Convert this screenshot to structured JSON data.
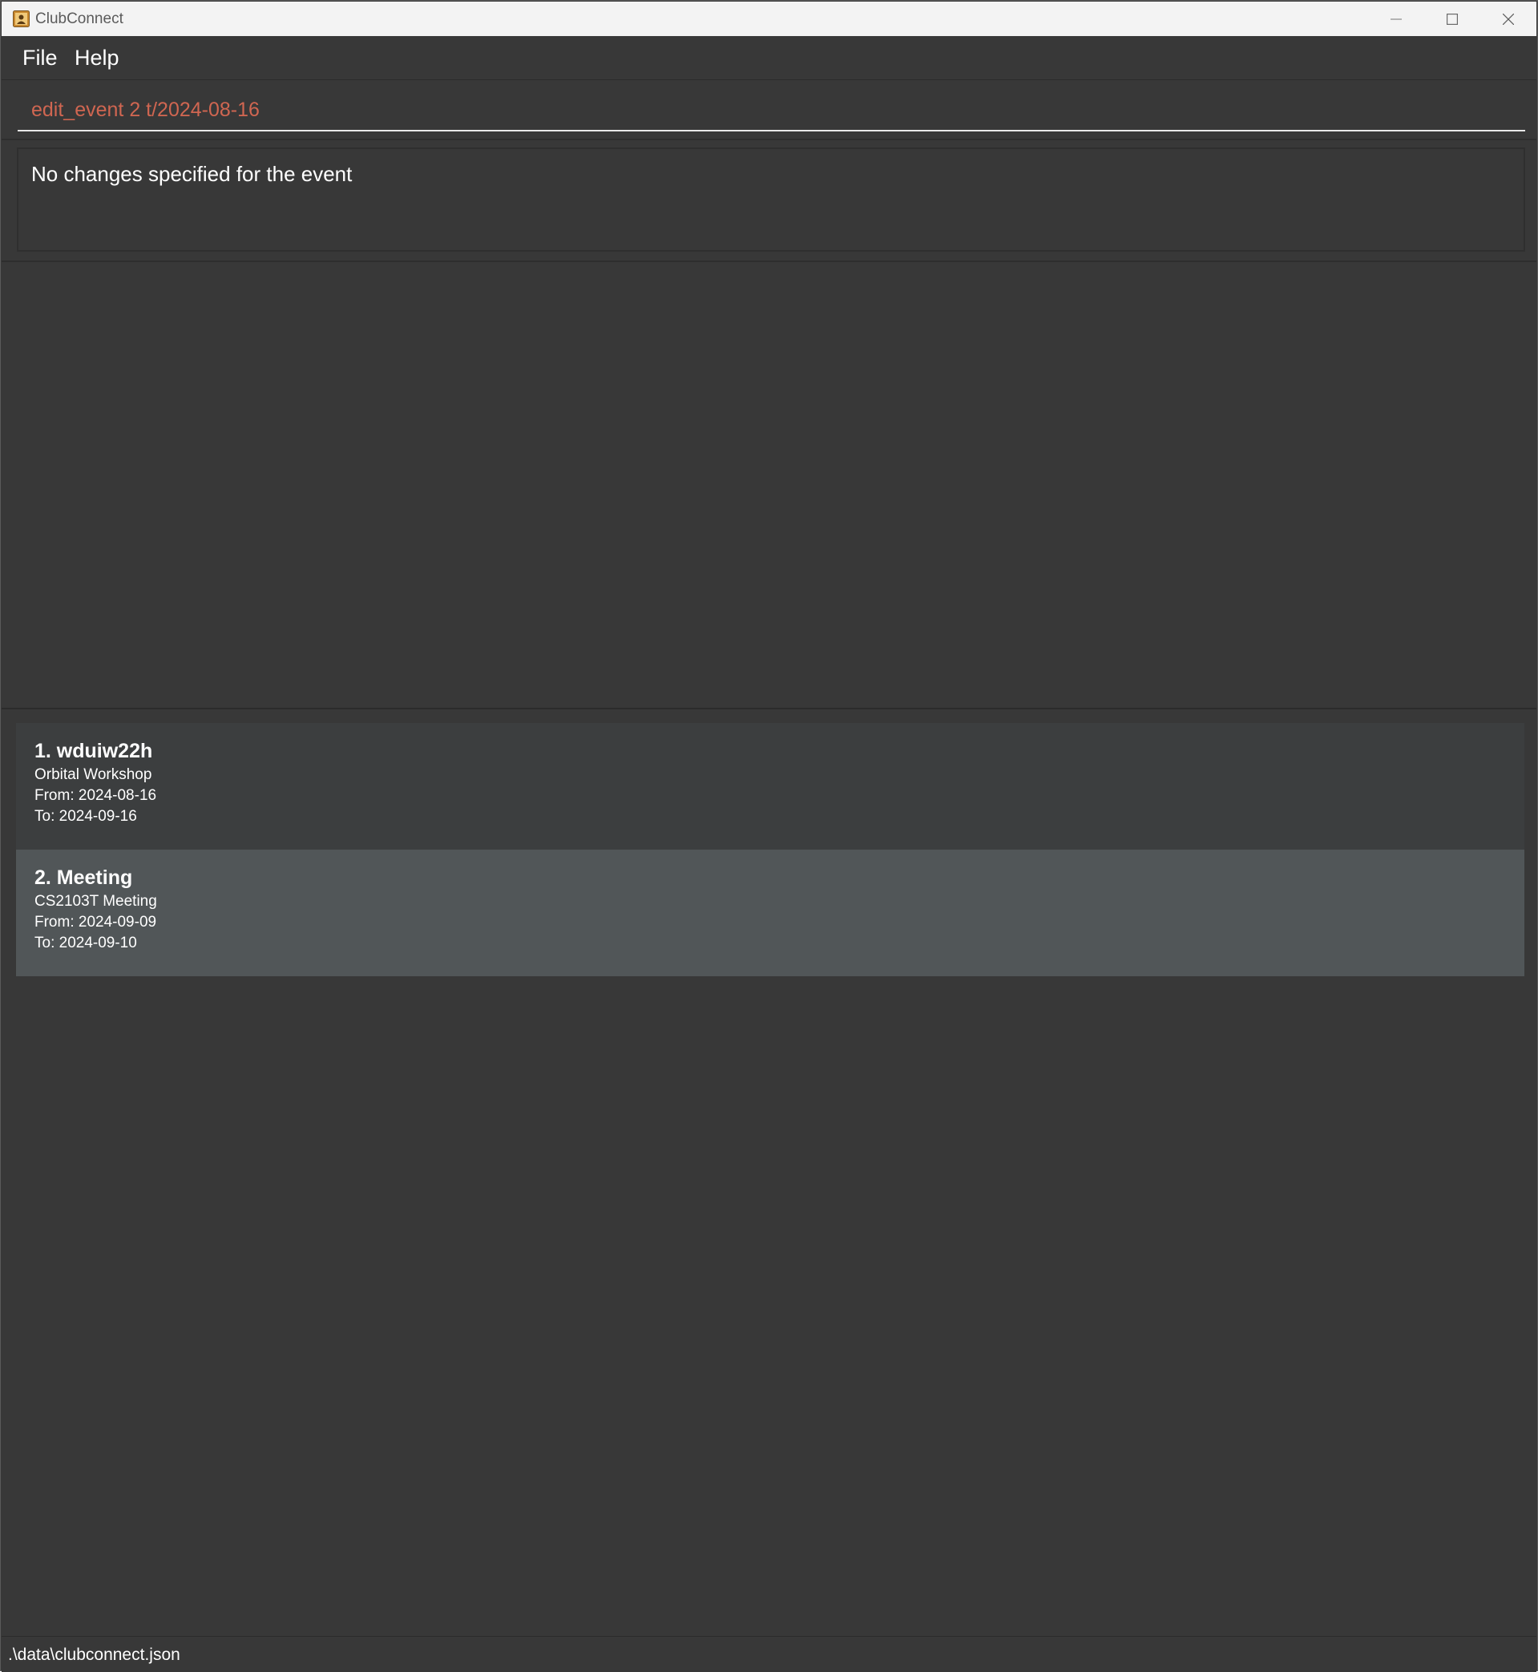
{
  "window": {
    "title": "ClubConnect",
    "app_icon": "contact-book-icon",
    "controls": {
      "minimize_icon": "minimize-icon",
      "maximize_icon": "maximize-icon",
      "close_icon": "close-icon"
    }
  },
  "menu": {
    "items": [
      {
        "label": "File"
      },
      {
        "label": "Help"
      }
    ]
  },
  "command": {
    "value": "edit_event 2 t/2024-08-16",
    "text_color": "#d06651"
  },
  "result": {
    "message": "No changes specified for the event"
  },
  "events": [
    {
      "heading": "1. wduiw22h",
      "description": "Orbital Workshop",
      "from": "From: 2024-08-16",
      "to": "To: 2024-09-16",
      "selected": false
    },
    {
      "heading": "2. Meeting",
      "description": "CS2103T Meeting",
      "from": "From: 2024-09-09",
      "to": "To: 2024-09-10",
      "selected": true
    }
  ],
  "status": {
    "file_path": ".\\data\\clubconnect.json"
  },
  "colors": {
    "background": "#383838",
    "selected_card": "#515658",
    "card": "#3c3e3f",
    "titlebar": "#f3f3f3"
  }
}
